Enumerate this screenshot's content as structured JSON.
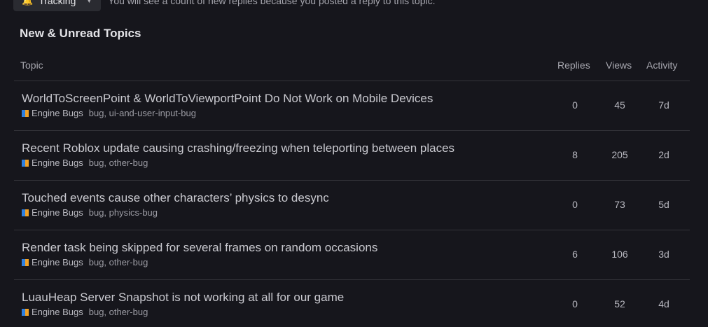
{
  "top": {
    "tracking_label": "Tracking",
    "note": "You will see a count of new replies because you posted a reply to this topic."
  },
  "section": {
    "title": "New & Unread Topics"
  },
  "columns": {
    "topic": "Topic",
    "replies": "Replies",
    "views": "Views",
    "activity": "Activity"
  },
  "category_icon_colors": [
    "#2d7fe0",
    "#f0a126"
  ],
  "topics": [
    {
      "title": "WorldToScreenPoint & WorldToViewportPoint Do Not Work on Mobile Devices",
      "category": "Engine Bugs",
      "tags": "bug, ui-and-user-input-bug",
      "replies": "0",
      "views": "45",
      "activity": "7d"
    },
    {
      "title": "Recent Roblox update causing crashing/freezing when teleporting between places",
      "category": "Engine Bugs",
      "tags": "bug, other-bug",
      "replies": "8",
      "views": "205",
      "activity": "2d"
    },
    {
      "title": "Touched events cause other characters’ physics to desync",
      "category": "Engine Bugs",
      "tags": "bug, physics-bug",
      "replies": "0",
      "views": "73",
      "activity": "5d"
    },
    {
      "title": "Render task being skipped for several frames on random occasions",
      "category": "Engine Bugs",
      "tags": "bug, other-bug",
      "replies": "6",
      "views": "106",
      "activity": "3d"
    },
    {
      "title": "LuauHeap Server Snapshot is not working at all for our game",
      "category": "Engine Bugs",
      "tags": "bug, other-bug",
      "replies": "0",
      "views": "52",
      "activity": "4d"
    }
  ]
}
